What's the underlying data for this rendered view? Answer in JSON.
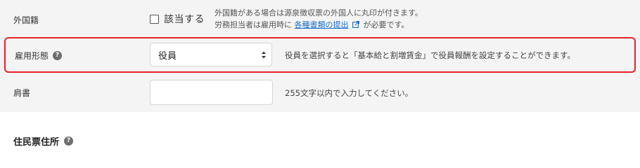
{
  "rows": {
    "foreign": {
      "label": "外国籍",
      "checkbox_label": "該当する",
      "note_line1": "外国籍がある場合は源泉徴収票の外国人に丸印が付きます。",
      "note_line2_prefix": "労務担当者は雇用時に",
      "note_link": "各種書類の提出",
      "note_line2_suffix": "が必要です。"
    },
    "employment": {
      "label": "雇用形態",
      "help_icon": "?",
      "selected": "役員",
      "help_text": "役員を選択すると「基本給と割増賃金」で役員報酬を設定することができます。"
    },
    "title": {
      "label": "肩書",
      "value": "",
      "help_text": "255文字以内で入力してください。"
    }
  },
  "section": {
    "heading": "住民票住所",
    "help_icon": "?"
  },
  "colors": {
    "highlight_border": "#e8202a",
    "form_background": "#f4f4f4",
    "link": "#1a6fd0"
  }
}
